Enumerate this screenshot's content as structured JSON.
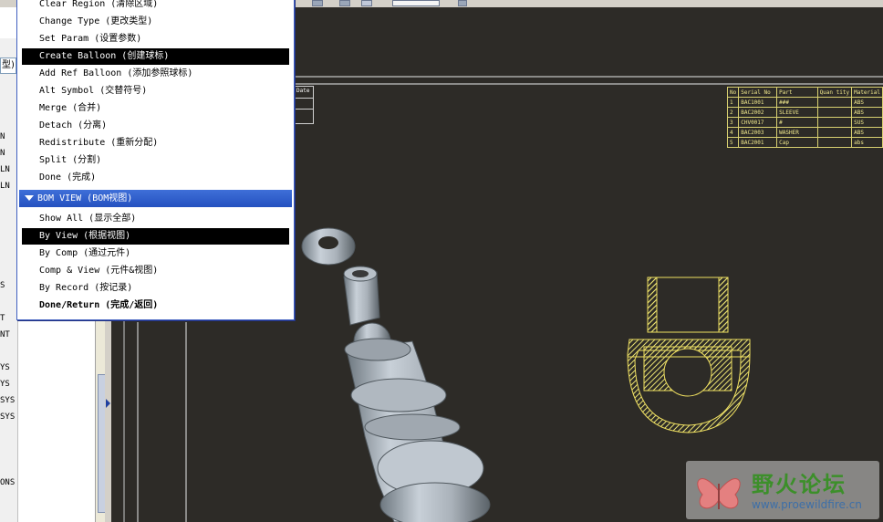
{
  "menu": {
    "items_top": [
      {
        "label": "Clear Region (清除区域)"
      },
      {
        "label": "Change Type (更改类型)"
      },
      {
        "label": "Set Param (设置参数)"
      },
      {
        "label": "Create Balloon (创建球标)",
        "selected": true
      },
      {
        "label": "Add Ref Balloon (添加参照球标)"
      },
      {
        "label": "Alt Symbol (交替符号)"
      },
      {
        "label": "Merge (合并)"
      },
      {
        "label": "Detach (分离)"
      },
      {
        "label": "Redistribute (重新分配)"
      },
      {
        "label": "Split (分割)"
      },
      {
        "label": "Done (完成)"
      }
    ],
    "section_title": "BOM VIEW (BOM视图)",
    "items_bottom": [
      {
        "label": "Show All (显示全部)"
      },
      {
        "label": "By View (根据视图)",
        "selected": true
      },
      {
        "label": "By Comp (通过元件)"
      },
      {
        "label": "Comp & View (元件&视图)"
      },
      {
        "label": "By Record (按记录)"
      },
      {
        "label": "Done/Return (完成/返回)",
        "bold": true
      }
    ]
  },
  "left_panel": {
    "dropdown_text": "型)",
    "tree_items": [
      "N",
      "N",
      "LN",
      "LN",
      "S",
      "T",
      "NT",
      "YS",
      "YS",
      "SYS",
      "SYS",
      "ONS"
    ]
  },
  "drawing": {
    "small_header_label": "Date",
    "bom_table": {
      "headers": [
        "No",
        "Serial No",
        "Part",
        "Quan tity",
        "Material"
      ],
      "rows": [
        [
          "1",
          "BAC1001",
          "###",
          "",
          "ABS"
        ],
        [
          "2",
          "BAC2002",
          "SLEEVE",
          "",
          "ABS"
        ],
        [
          "3",
          "CHV0017",
          "#",
          "",
          "SUS"
        ],
        [
          "4",
          "BAC2003",
          "WASHER",
          "",
          "ABS"
        ],
        [
          "5",
          "BAC2001",
          "Cap",
          "",
          "abs"
        ]
      ]
    }
  },
  "watermark": {
    "title": "野火论坛",
    "url": "www.proewildfire.cn"
  },
  "colors": {
    "canvas_bg": "#2d2b27",
    "menu_selection": "#000000",
    "section_header": "#2f5fcc",
    "section_color": "#f0e050",
    "table_text": "#f0e88c"
  }
}
